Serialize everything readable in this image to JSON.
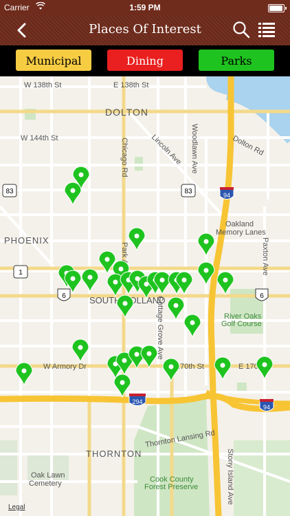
{
  "status_bar": {
    "carrier": "Carrier",
    "time": "1:59 PM"
  },
  "nav": {
    "title": "Places Of Interest",
    "back_icon": "chevron-left-icon",
    "search_icon": "search-icon",
    "list_icon": "list-icon"
  },
  "filters": [
    {
      "label": "Municipal",
      "color": "#f6cc43"
    },
    {
      "label": "Dining",
      "color": "#ea1f1f"
    },
    {
      "label": "Parks",
      "color": "#1fc31f"
    }
  ],
  "map": {
    "pin_color": "#1fc31f",
    "labels": {
      "w138": "W 138th St",
      "e138": "E 138th St",
      "dolton": "DOLTON",
      "w144": "W 144th St",
      "dolton_rd": "Dolton Rd",
      "lincoln": "Lincoln Ave",
      "woodlawn": "Woodlawn Ave",
      "chicago": "Chicago Rd",
      "oakland": "Oakland",
      "memory": "Memory Lanes",
      "phoenix": "PHOENIX",
      "paxton": "Paxton Ave",
      "park": "Park Ave",
      "south_holland": "SOUTH HOLLAND",
      "river_oaks": "River Oaks",
      "golf": "Golf Course",
      "cottage": "Cottage Grove Ave",
      "w_armory": "W Armory Dr",
      "w170": "170th St",
      "e170": "E 170",
      "thornton": "THORNTON",
      "thornton_lansing": "Thornton Lansing Rd",
      "stony": "Stony Island Ave",
      "oak_lawn": "Oak Lawn",
      "cemetery": "Cemetery",
      "cook": "Cook County",
      "preserve": "Forest Preserve",
      "legal": "Legal",
      "shield_83a": "83",
      "shield_83b": "83",
      "shield_94a": "94",
      "shield_94b": "94",
      "shield_6a": "6",
      "shield_6b": "6",
      "shield_1": "1",
      "shield_294": "294"
    }
  }
}
